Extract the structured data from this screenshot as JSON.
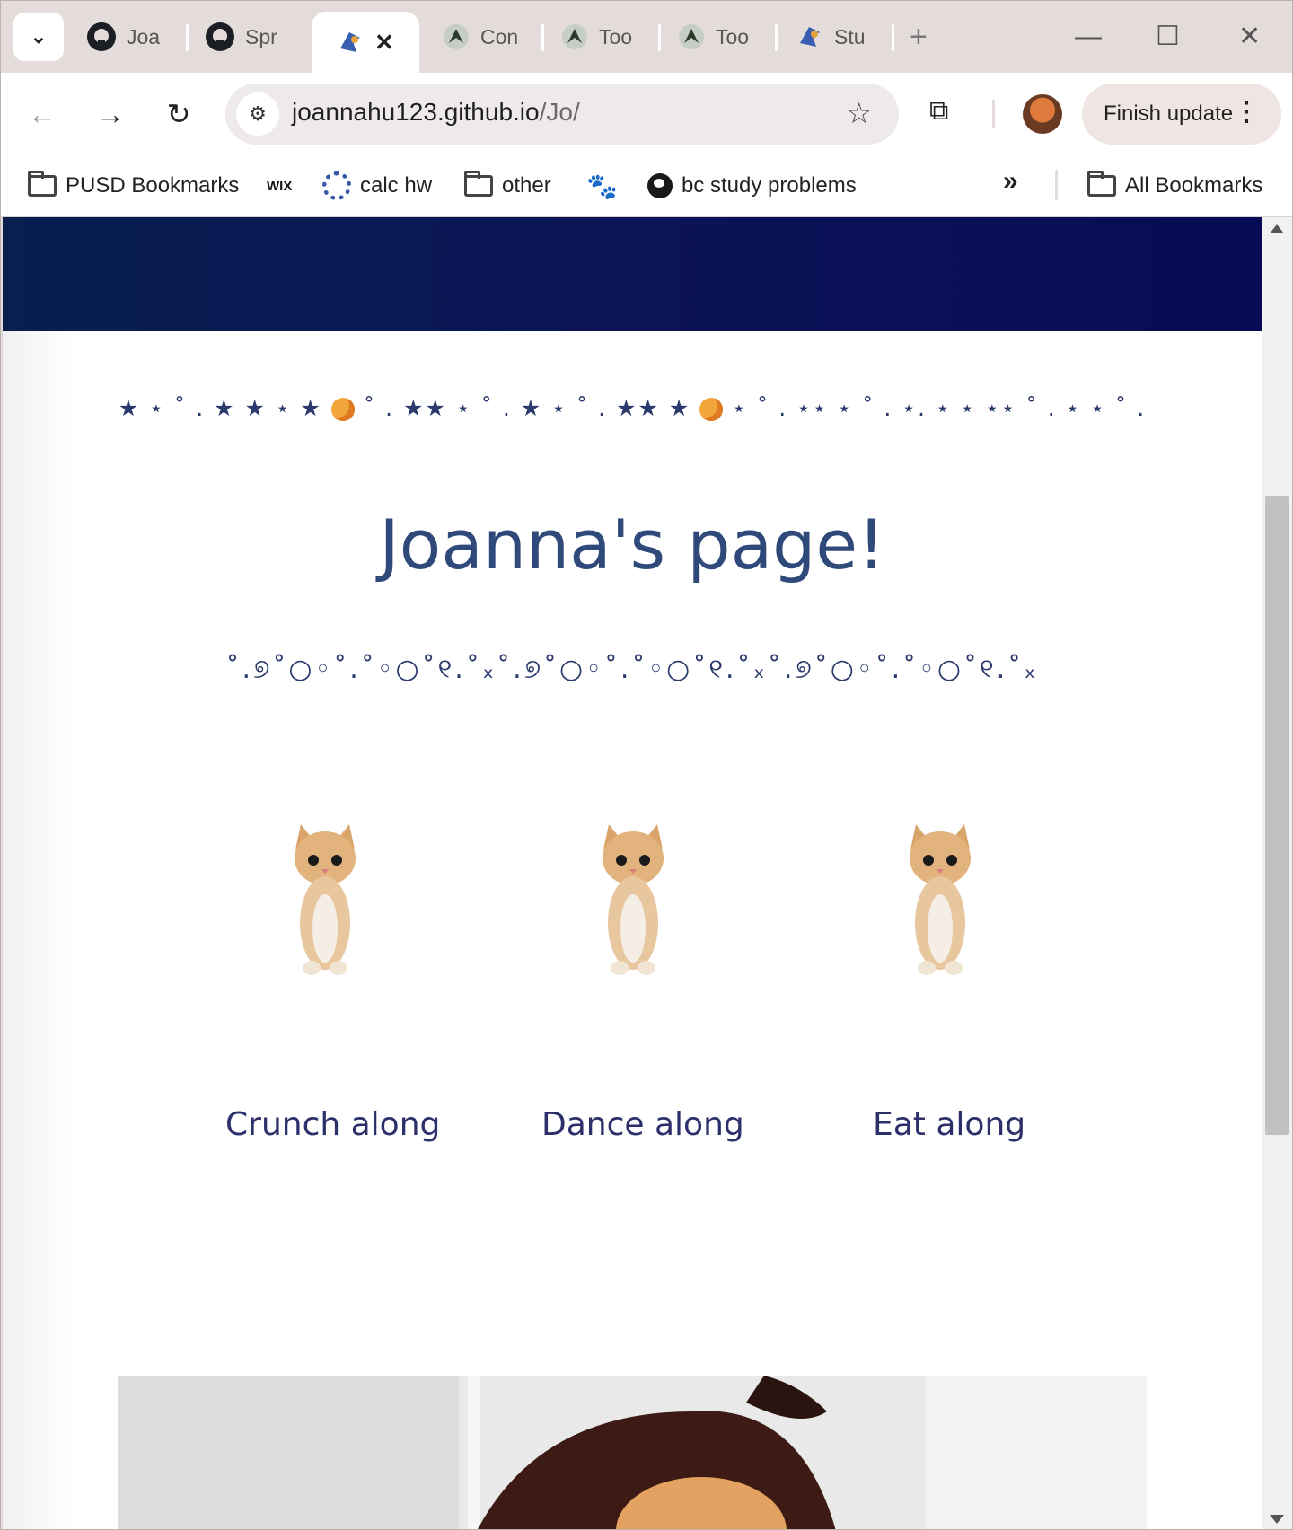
{
  "browser": {
    "tabs": [
      {
        "label": "Joa",
        "icon": "github-icon"
      },
      {
        "label": "Spr",
        "icon": "github-icon"
      },
      {
        "label": "",
        "icon": "site-icon",
        "active": true
      },
      {
        "label": "Con",
        "icon": "wing-icon"
      },
      {
        "label": "Too",
        "icon": "wing-icon"
      },
      {
        "label": "Too",
        "icon": "wing-icon"
      },
      {
        "label": "Stu",
        "icon": "site-icon"
      }
    ],
    "close_tab_glyph": "✕",
    "new_tab_glyph": "+",
    "window_controls": {
      "minimize": "—",
      "maximize": "☐",
      "close": "✕"
    },
    "url_host": "joannahu123.github.io",
    "url_path": "/Jo/",
    "finish_update_label": "Finish update",
    "bookmarks": [
      {
        "label": "PUSD Bookmarks",
        "icon": "managed-folder-icon"
      },
      {
        "label": "",
        "icon": "wix-icon",
        "icon_text": "WIX"
      },
      {
        "label": "calc hw",
        "icon": "calc-icon"
      },
      {
        "label": "other",
        "icon": "folder-icon"
      },
      {
        "label": "",
        "icon": "paw-icon"
      },
      {
        "label": "bc study problems",
        "icon": "globe-icon"
      }
    ],
    "all_bookmarks_label": "All Bookmarks"
  },
  "page": {
    "hero_colors": [
      "#081f50",
      "#080b55"
    ],
    "deco_line_1": "★ ⋆ ˚ . ★ ★ ⋆ ★",
    "deco_line_1b": "˚ . ★★ ⋆ ˚ . ★ ⋆ ˚ . ★★ ★",
    "deco_line_1c": "⋆ ˚ . ⋆⋆ ⋆ ˚ . ⋆. ⋆ ⋆ ⋆⋆ ˚ . ⋆ ⋆ ˚ .",
    "title": "Joanna's page!",
    "deco_line_2": "˚.୭˚○◦˚.˚◦○˚୧.˚ₓ˚.୭˚○◦˚.˚◦○˚୧.˚ₓ˚.୭˚○◦˚.˚◦○˚୧.˚ₓ",
    "cats": [
      {
        "label": "Crunch along"
      },
      {
        "label": "Dance along"
      },
      {
        "label": "Eat along"
      }
    ]
  }
}
